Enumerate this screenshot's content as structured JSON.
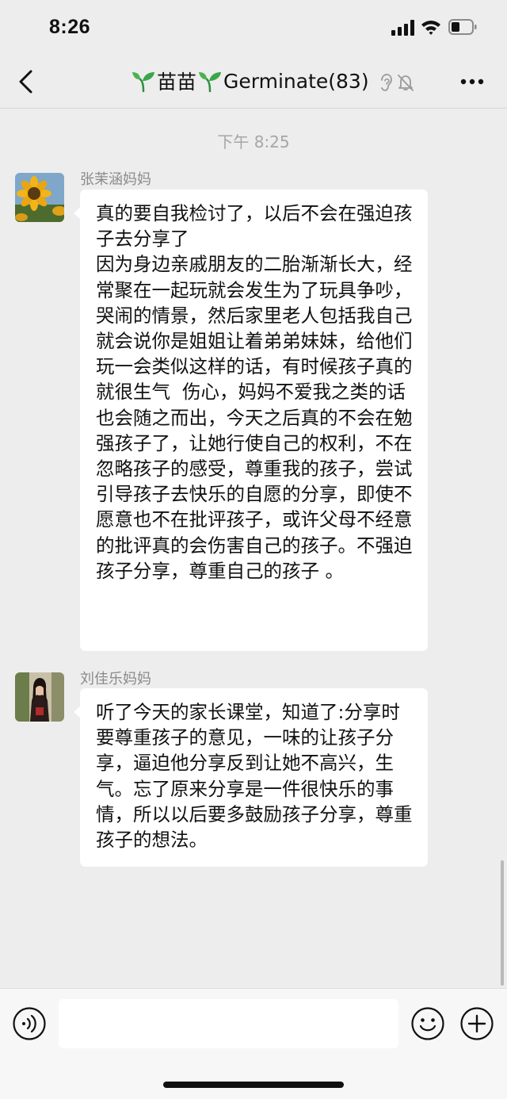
{
  "status_bar": {
    "time": "8:26"
  },
  "nav": {
    "title": "苗苗",
    "title_suffix": "Germinate(83)",
    "icons": [
      "back-icon",
      "sprout-icon",
      "ear-icon",
      "mute-icon",
      "more-icon"
    ]
  },
  "chat": {
    "timestamp": "下午 8:25",
    "messages": [
      {
        "sender": "张茉涵妈妈",
        "avatar": "sunflower-avatar",
        "text": "真的要自我检讨了，以后不会在强迫孩子去分享了\n因为身边亲戚朋友的二胎渐渐长大，经常聚在一起玩就会发生为了玩具争吵，哭闹的情景，然后家里老人包括我自己就会说你是姐姐让着弟弟妹妹，给他们玩一会类似这样的话，有时候孩子真的就很生气  伤心，妈妈不爱我之类的话也会随之而出，今天之后真的不会在勉强孩子了，让她行使自己的权利，不在忽略孩子的感受，尊重我的孩子，尝试引导孩子去快乐的自愿的分享，即使不愿意也不在批评孩子，或许父母不经意的批评真的会伤害自己的孩子。不强迫孩子分享，尊重自己的孩子 。"
      },
      {
        "sender": "刘佳乐妈妈",
        "avatar": "woman-portrait-avatar",
        "text": "听了今天的家长课堂，知道了:分享时要尊重孩子的意见，一味的让孩子分享，逼迫他分享反到让她不高兴，生气。忘了原来分享是一件很快乐的事情，所以以后要多鼓励孩子分享，尊重孩子的想法。"
      }
    ]
  },
  "input_bar": {
    "placeholder": "",
    "icons": [
      "voice-icon",
      "emoji-icon",
      "plus-icon"
    ]
  },
  "colors": {
    "background": "#ededed",
    "bubble": "#ffffff",
    "sender_name": "#8a8a8a",
    "timestamp": "#a6a6a6",
    "sprout": "#3aa74a"
  }
}
